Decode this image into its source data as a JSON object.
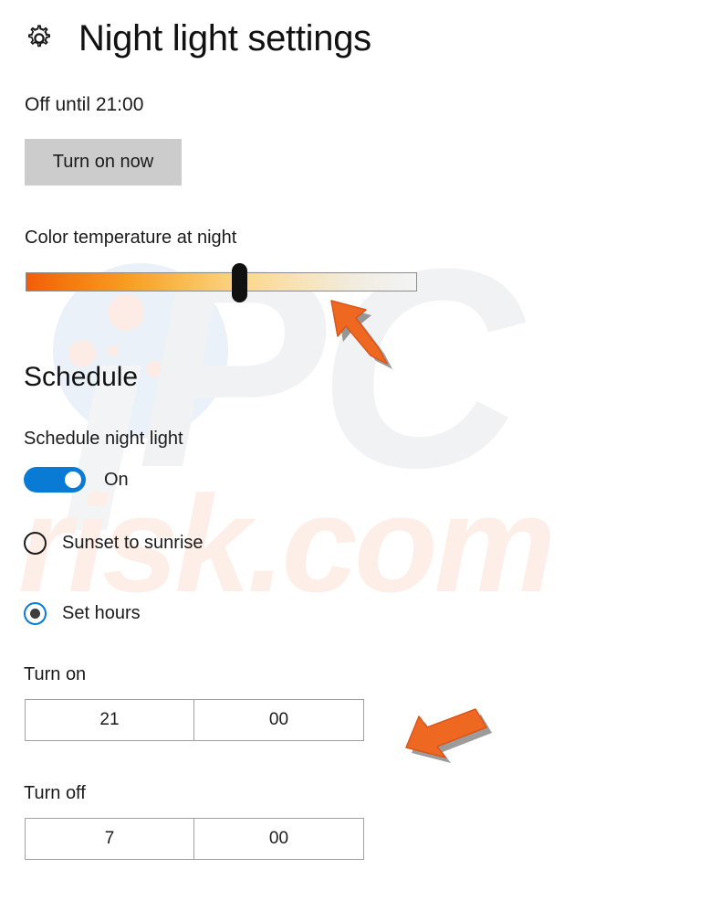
{
  "header": {
    "icon": "gear-icon",
    "title": "Night light settings"
  },
  "status": {
    "text": "Off until 21:00"
  },
  "actions": {
    "turn_on_now_label": "Turn on now"
  },
  "color_temperature": {
    "label": "Color temperature at night",
    "value_percent": 55,
    "gradient_from": "#f35c0a",
    "gradient_to": "#f4f4f2",
    "thumb_color": "#111111"
  },
  "schedule": {
    "heading": "Schedule",
    "toggle_label": "Schedule night light",
    "toggle_state": "On",
    "toggle_on": true,
    "accent_color": "#0a7bd4",
    "options": [
      {
        "label": "Sunset to sunrise",
        "selected": false
      },
      {
        "label": "Set hours",
        "selected": true
      }
    ],
    "turn_on": {
      "label": "Turn on",
      "hours": "21",
      "minutes": "00"
    },
    "turn_off": {
      "label": "Turn off",
      "hours": "7",
      "minutes": "00"
    }
  },
  "annotations": {
    "arrow_color": "#ef6822",
    "arrows": [
      {
        "name": "arrow-pointing-to-slider",
        "direction": "up-left"
      },
      {
        "name": "arrow-pointing-to-turn-on-time",
        "direction": "down-left"
      }
    ]
  },
  "watermark": {
    "primary_text": "PC",
    "secondary_text": "risk.com",
    "primary_color": "#f1f2f3",
    "secondary_color": "#fdeee7"
  }
}
